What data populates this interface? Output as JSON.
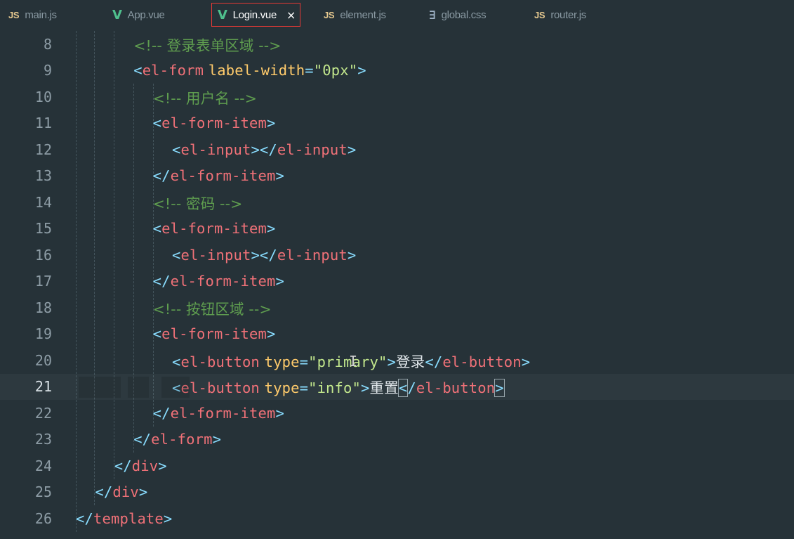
{
  "tabs": [
    {
      "icon": "js-icon",
      "glyph": "JS",
      "label": "main.js"
    },
    {
      "icon": "vue-icon",
      "glyph": "V",
      "label": "App.vue"
    },
    {
      "icon": "vue-icon",
      "glyph": "V",
      "label": "Login.vue",
      "close": "×"
    },
    {
      "icon": "js-icon",
      "glyph": "JS",
      "label": "element.js"
    },
    {
      "icon": "css-icon",
      "glyph": "∃",
      "label": "global.css"
    },
    {
      "icon": "js-icon",
      "glyph": "JS",
      "label": "router.js"
    }
  ],
  "editor": {
    "current_line": 21,
    "lines": [
      {
        "n": "8",
        "t": [
          [
            "c",
            "<!-- 登录表单区域 -->"
          ]
        ]
      },
      {
        "n": "9",
        "t": [
          [
            "b",
            "<"
          ],
          [
            "g",
            "el-form"
          ],
          [
            "x",
            " "
          ],
          [
            "a",
            "label-width"
          ],
          [
            "e",
            "="
          ],
          [
            "s",
            "\"0px\""
          ],
          [
            "b",
            ">"
          ]
        ]
      },
      {
        "n": "10",
        "t": [
          [
            "c",
            "<!-- 用户名 -->"
          ]
        ]
      },
      {
        "n": "11",
        "t": [
          [
            "b",
            "<"
          ],
          [
            "g",
            "el-form-item"
          ],
          [
            "b",
            ">"
          ]
        ]
      },
      {
        "n": "12",
        "t": [
          [
            "b",
            "<"
          ],
          [
            "g",
            "el-input"
          ],
          [
            "b",
            "></"
          ],
          [
            "g",
            "el-input"
          ],
          [
            "b",
            ">"
          ]
        ]
      },
      {
        "n": "13",
        "t": [
          [
            "b",
            "</"
          ],
          [
            "g",
            "el-form-item"
          ],
          [
            "b",
            ">"
          ]
        ]
      },
      {
        "n": "14",
        "t": [
          [
            "c",
            "<!-- 密码 -->"
          ]
        ]
      },
      {
        "n": "15",
        "t": [
          [
            "b",
            "<"
          ],
          [
            "g",
            "el-form-item"
          ],
          [
            "b",
            ">"
          ]
        ]
      },
      {
        "n": "16",
        "t": [
          [
            "b",
            "<"
          ],
          [
            "g",
            "el-input"
          ],
          [
            "b",
            "></"
          ],
          [
            "g",
            "el-input"
          ],
          [
            "b",
            ">"
          ]
        ]
      },
      {
        "n": "17",
        "t": [
          [
            "b",
            "</"
          ],
          [
            "g",
            "el-form-item"
          ],
          [
            "b",
            ">"
          ]
        ]
      },
      {
        "n": "18",
        "t": [
          [
            "c",
            "<!-- 按钮区域 -->"
          ]
        ]
      },
      {
        "n": "19",
        "t": [
          [
            "b",
            "<"
          ],
          [
            "g",
            "el-form-item"
          ],
          [
            "b",
            ">"
          ]
        ]
      },
      {
        "n": "20",
        "t": [
          [
            "b",
            "<"
          ],
          [
            "g",
            "el-button"
          ],
          [
            "x",
            " "
          ],
          [
            "a",
            "type"
          ],
          [
            "e",
            "="
          ],
          [
            "s",
            "\"primary\""
          ],
          [
            "b",
            ">"
          ],
          [
            "x",
            "登录"
          ],
          [
            "b",
            "</"
          ],
          [
            "g",
            "el-button"
          ],
          [
            "b",
            ">"
          ]
        ]
      },
      {
        "n": "21",
        "t": [
          [
            "b",
            "<"
          ],
          [
            "g",
            "el-button"
          ],
          [
            "x",
            " "
          ],
          [
            "a",
            "type"
          ],
          [
            "e",
            "="
          ],
          [
            "s",
            "\"info\""
          ],
          [
            "b",
            ">"
          ],
          [
            "x",
            "重置"
          ],
          [
            "bh",
            "<"
          ],
          [
            "b",
            "/"
          ],
          [
            "g",
            "el-button"
          ],
          [
            "bh",
            ">"
          ]
        ]
      },
      {
        "n": "22",
        "t": [
          [
            "b",
            "</"
          ],
          [
            "g",
            "el-form-item"
          ],
          [
            "b",
            ">"
          ]
        ]
      },
      {
        "n": "23",
        "t": [
          [
            "b",
            "</"
          ],
          [
            "g",
            "el-form"
          ],
          [
            "b",
            ">"
          ]
        ]
      },
      {
        "n": "24",
        "t": [
          [
            "b",
            "</"
          ],
          [
            "g",
            "div"
          ],
          [
            "b",
            ">"
          ]
        ]
      },
      {
        "n": "25",
        "t": [
          [
            "b",
            "</"
          ],
          [
            "g",
            "div"
          ],
          [
            "b",
            ">"
          ]
        ]
      },
      {
        "n": "26",
        "t": [
          [
            "b",
            "</"
          ],
          [
            "g",
            "template"
          ],
          [
            "b",
            ">"
          ]
        ]
      }
    ]
  }
}
